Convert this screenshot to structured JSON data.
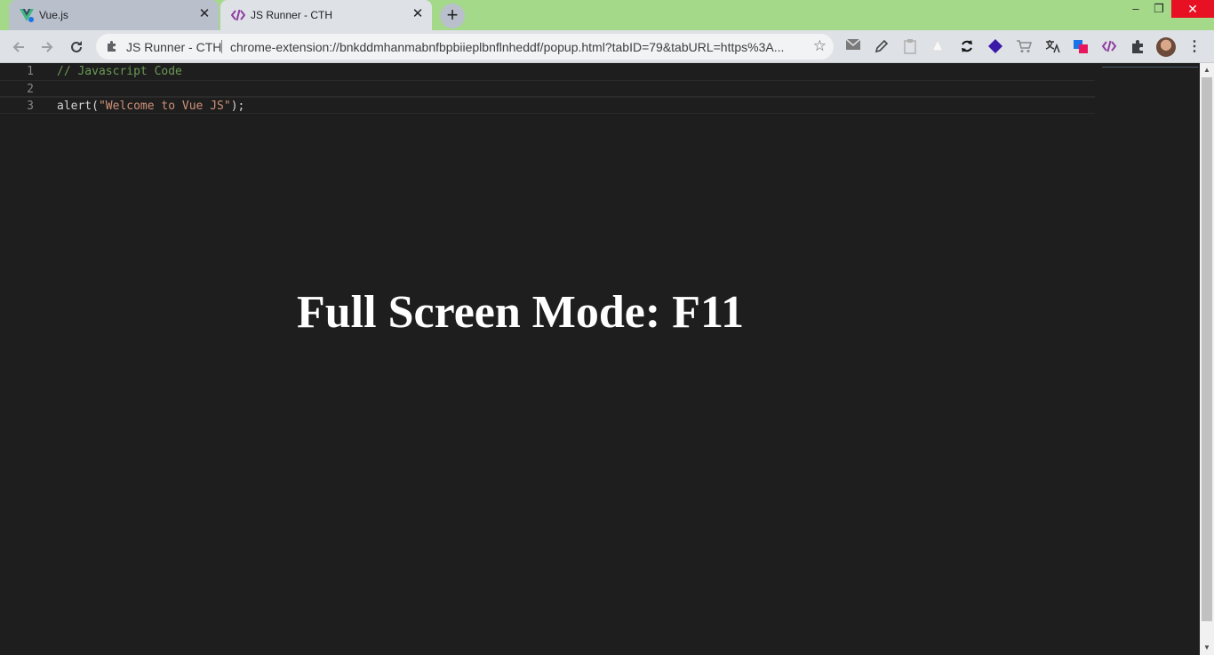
{
  "tabs": [
    {
      "title": "Vue.js",
      "favicon": "vue-logo-icon",
      "active": false
    },
    {
      "title": "JS Runner - CTH",
      "favicon": "code-brackets-icon",
      "active": true
    }
  ],
  "window_controls": {
    "minimize": "–",
    "maximize": "❐",
    "close": "✕"
  },
  "toolbar": {
    "site_label": "JS Runner - CTH",
    "url": "chrome-extension://bnkddmhanmabnfbpbiieplbnflnheddf/popup.html?tabID=79&tabURL=https%3A...",
    "extensions": [
      "mail-icon",
      "pen-icon",
      "clipboard-icon",
      "triangle-icon",
      "sync-icon",
      "shield-icon",
      "cart-icon",
      "translate-icon",
      "layers-icon",
      "code-brackets-icon",
      "puzzle-icon"
    ]
  },
  "editor": {
    "lines": [
      {
        "number": "1",
        "tokens": [
          {
            "type": "comment",
            "text": "// Javascript Code"
          }
        ]
      },
      {
        "number": "2",
        "tokens": []
      },
      {
        "number": "3",
        "tokens": [
          {
            "type": "plain",
            "text": "alert("
          },
          {
            "type": "string",
            "text": "\"Welcome to Vue JS\""
          },
          {
            "type": "plain",
            "text": ");"
          }
        ]
      }
    ]
  },
  "overlay_text": "Full Screen Mode: F11",
  "colors": {
    "tabstrip": "#a4d98a",
    "editor_bg": "#1e1e1e",
    "comment": "#6a9955",
    "string": "#ce9178"
  }
}
